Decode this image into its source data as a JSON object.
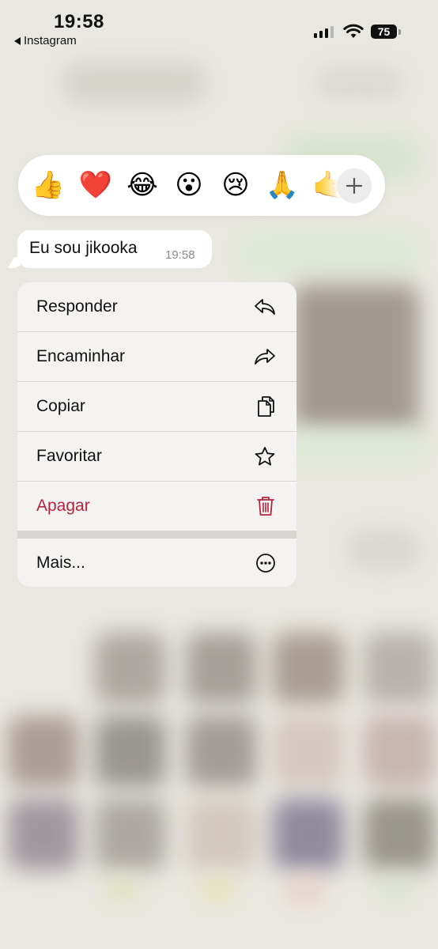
{
  "status_bar": {
    "time": "19:58",
    "back_app": "Instagram",
    "battery": "75"
  },
  "reactions": {
    "emojis": [
      {
        "name": "thumbs-up",
        "char": "👍"
      },
      {
        "name": "red-heart",
        "char": "❤️"
      },
      {
        "name": "tears-of-joy",
        "char": "😂"
      },
      {
        "name": "surprised",
        "char": "😮"
      },
      {
        "name": "crying",
        "char": "😢"
      },
      {
        "name": "folded-hands",
        "char": "🙏"
      },
      {
        "name": "partial-hand",
        "char": "🤙"
      }
    ],
    "more_icon": "plus-icon"
  },
  "message": {
    "text": "Eu sou jikooka",
    "time": "19:58"
  },
  "menu": {
    "items": [
      {
        "label": "Responder",
        "icon": "reply-icon"
      },
      {
        "label": "Encaminhar",
        "icon": "forward-icon"
      },
      {
        "label": "Copiar",
        "icon": "copy-icon"
      },
      {
        "label": "Favoritar",
        "icon": "star-icon"
      },
      {
        "label": "Apagar",
        "icon": "trash-icon",
        "color": "#b3243f"
      },
      {
        "label": "Mais...",
        "icon": "more-icon"
      }
    ]
  }
}
